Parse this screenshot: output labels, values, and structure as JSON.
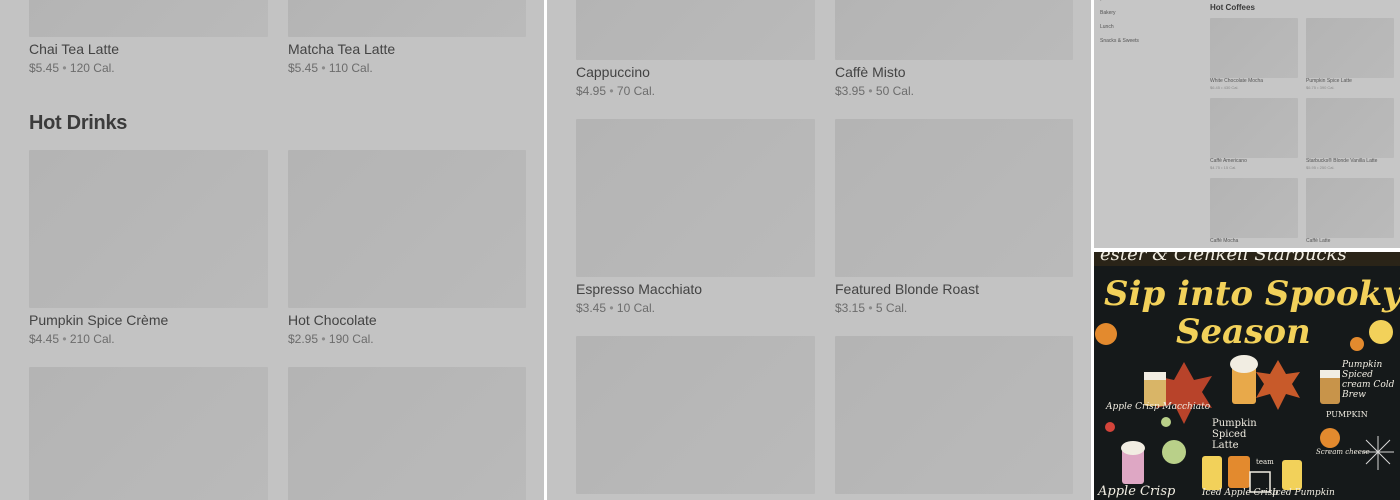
{
  "panel1": {
    "top_items": [
      {
        "name": "Chai Tea Latte",
        "price": "$5.45",
        "cal": "120 Cal."
      },
      {
        "name": "Matcha Tea Latte",
        "price": "$5.45",
        "cal": "110 Cal."
      }
    ],
    "section_title": "Hot Drinks",
    "items": [
      {
        "name": "Pumpkin Spice Crème",
        "price": "$4.45",
        "cal": "210 Cal."
      },
      {
        "name": "Hot Chocolate",
        "price": "$2.95",
        "cal": "190 Cal."
      }
    ]
  },
  "panel2": {
    "items": [
      {
        "name": "Cappuccino",
        "price": "$4.95",
        "cal": "70 Cal."
      },
      {
        "name": "Caffè Misto",
        "price": "$3.95",
        "cal": "50 Cal."
      },
      {
        "name": "Espresso Macchiato",
        "price": "$3.45",
        "cal": "10 Cal."
      },
      {
        "name": "Featured Blonde Roast",
        "price": "$3.15",
        "cal": "5 Cal."
      }
    ]
  },
  "panel3": {
    "nav": [
      "Bakery",
      "Lunch",
      "Snacks & Sweets"
    ],
    "section_title": "Hot Coffees",
    "items": [
      {
        "name": "White Chocolate Mocha",
        "meta": "$6.45 • 430 Cal."
      },
      {
        "name": "Pumpkin Spice Latte",
        "meta": "$6.75 • 390 Cal."
      },
      {
        "name": "Caffè Americano",
        "meta": "$4.75 • 15 Cal."
      },
      {
        "name": "Starbucks® Blonde Vanilla Latte",
        "meta": "$5.95 • 250 Cal."
      },
      {
        "name": "Caffè Mocha",
        "meta": ""
      },
      {
        "name": "Caffè Latte",
        "meta": ""
      }
    ]
  },
  "chalkboard": {
    "line1": "Sip into Spooky",
    "line2": "Season",
    "labels": [
      "Apple Crisp Macchiato",
      "Pumpkin Spiced Latte",
      "Pumpkin Spiced cream Cold Brew",
      "PUMPKIN",
      "Scream cheese",
      "team",
      "Apple Crisp",
      "Iced Apple Crisp",
      "Iced Pumpkin"
    ]
  },
  "colors": {
    "chalk_yellow": "#f2d15a",
    "chalk_orange": "#e38a2e",
    "chalk_white": "#f1ede2",
    "chalkboard": "#15191a"
  }
}
